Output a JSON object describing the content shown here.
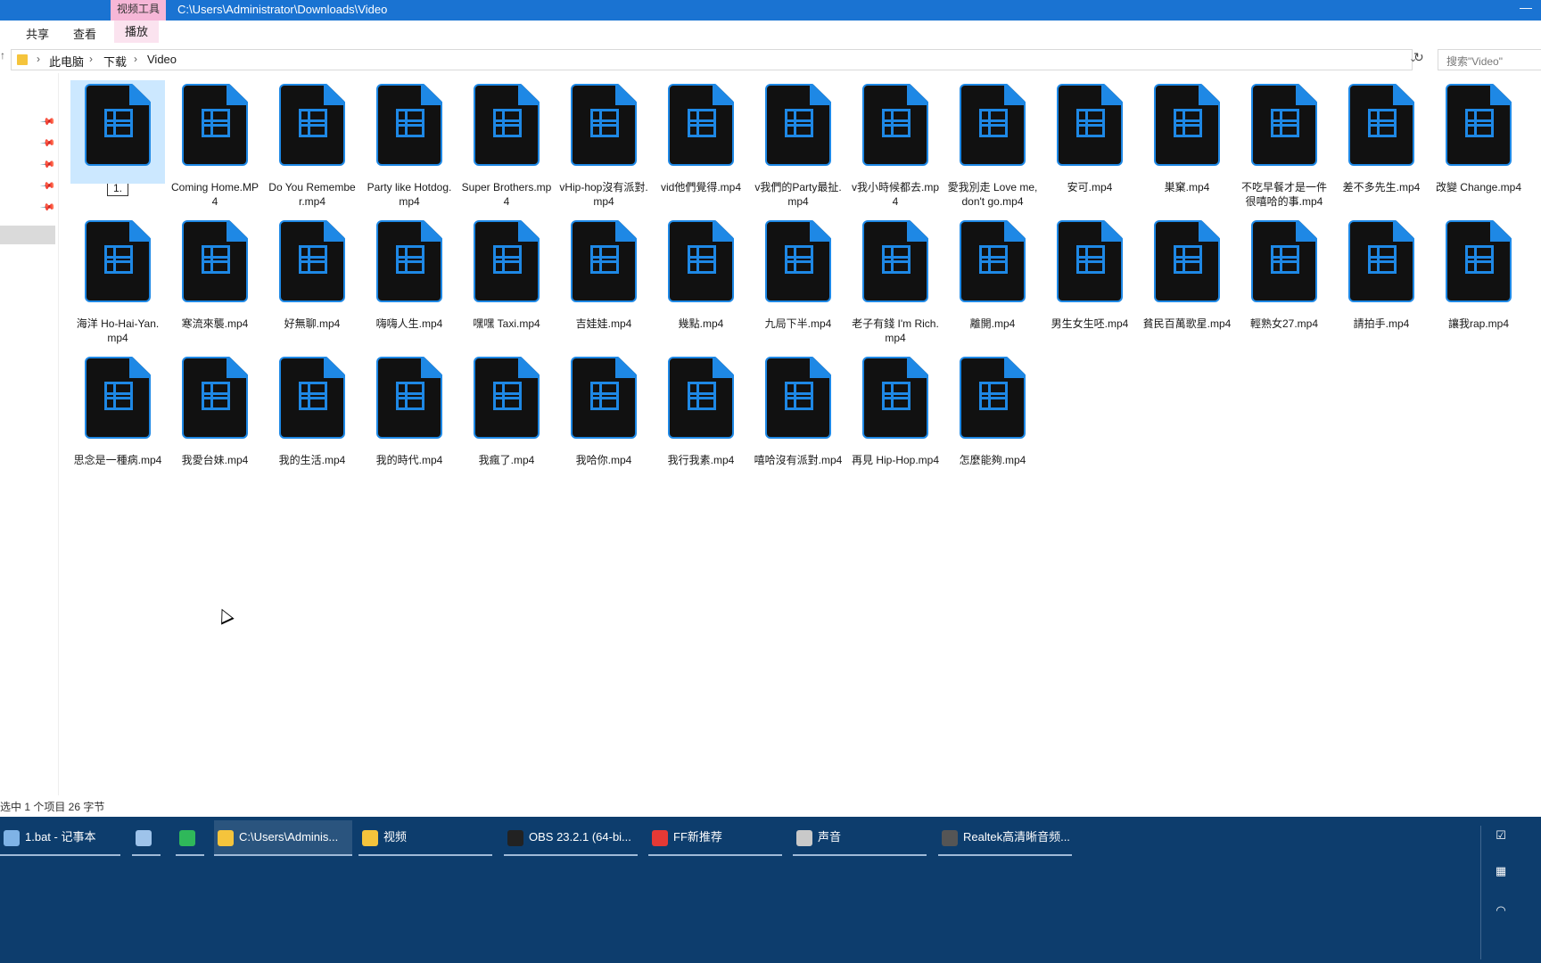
{
  "window": {
    "context_tab": "视频工具",
    "title": "C:\\Users\\Administrator\\Downloads\\Video",
    "minimize": "—"
  },
  "ribbon": {
    "tabs": [
      "共享",
      "查看",
      "播放"
    ]
  },
  "address": {
    "crumbs": [
      "此电脑",
      "下载",
      "Video"
    ],
    "search_placeholder": "搜索\"Video\""
  },
  "files": [
    {
      "label": "1.",
      "renaming": true
    },
    {
      "label": "Coming Home.MP4"
    },
    {
      "label": "Do You Remember.mp4"
    },
    {
      "label": "Party like Hotdog.mp4"
    },
    {
      "label": "Super Brothers.mp4"
    },
    {
      "label": "vHip-hop沒有派對.mp4"
    },
    {
      "label": "vid他們覺得.mp4"
    },
    {
      "label": "v我們的Party最扯.mp4"
    },
    {
      "label": "v我小時候都去.mp4"
    },
    {
      "label": "愛我別走 Love me,don't go.mp4"
    },
    {
      "label": "安可.mp4"
    },
    {
      "label": "巣窠.mp4"
    },
    {
      "label": "不吃早餐才是一件很嘻哈的事.mp4"
    },
    {
      "label": "差不多先生.mp4"
    },
    {
      "label": "改變 Change.mp4"
    },
    {
      "label": "海洋 Ho-Hai-Yan.mp4"
    },
    {
      "label": "寒流來襲.mp4"
    },
    {
      "label": "好無聊.mp4"
    },
    {
      "label": "嗨嗨人生.mp4"
    },
    {
      "label": "嘿嘿 Taxi.mp4"
    },
    {
      "label": "吉娃娃.mp4"
    },
    {
      "label": "幾點.mp4"
    },
    {
      "label": "九局下半.mp4"
    },
    {
      "label": "老子有錢 I'm Rich.mp4"
    },
    {
      "label": "離開.mp4"
    },
    {
      "label": "男生女生呸.mp4"
    },
    {
      "label": "貧民百萬歌星.mp4"
    },
    {
      "label": "輕熟女27.mp4"
    },
    {
      "label": "請拍手.mp4"
    },
    {
      "label": "讓我rap.mp4"
    },
    {
      "label": "思念是一種病.mp4"
    },
    {
      "label": "我愛台妹.mp4"
    },
    {
      "label": "我的生活.mp4"
    },
    {
      "label": "我的時代.mp4"
    },
    {
      "label": "我瘋了.mp4"
    },
    {
      "label": "我哈你.mp4"
    },
    {
      "label": "我行我素.mp4"
    },
    {
      "label": "嘻哈沒有派對.mp4"
    },
    {
      "label": "再見 Hip-Hop.mp4"
    },
    {
      "label": "怎麼能夠.mp4"
    }
  ],
  "status": {
    "text": "选中 1 个项目   26 字节"
  },
  "taskbar": {
    "items": [
      {
        "label": "1.bat - 记事本",
        "icon": "notepad-icon",
        "color": "#7fb3e6"
      },
      {
        "label": "",
        "icon": "network-computer-icon",
        "color": "#9ec3ea"
      },
      {
        "label": "",
        "icon": "green-app-icon",
        "color": "#2fb85a"
      },
      {
        "label": "C:\\Users\\Adminis...",
        "icon": "folder-icon",
        "color": "#f5c43c"
      },
      {
        "label": "视频",
        "icon": "folder-icon",
        "color": "#f5c43c"
      },
      {
        "label": "OBS 23.2.1 (64-bi...",
        "icon": "obs-icon",
        "color": "#222222"
      },
      {
        "label": "FF新推荐",
        "icon": "ff-icon",
        "color": "#e53935"
      },
      {
        "label": "声音",
        "icon": "speaker-icon",
        "color": "#c9c9c9"
      },
      {
        "label": "Realtek高清晰音频...",
        "icon": "realtek-speaker-icon",
        "color": "#555555"
      }
    ]
  },
  "colors": {
    "accent": "#1a73d2",
    "taskbar": "#0d3d6d",
    "icon_blue": "#1e88e5"
  }
}
